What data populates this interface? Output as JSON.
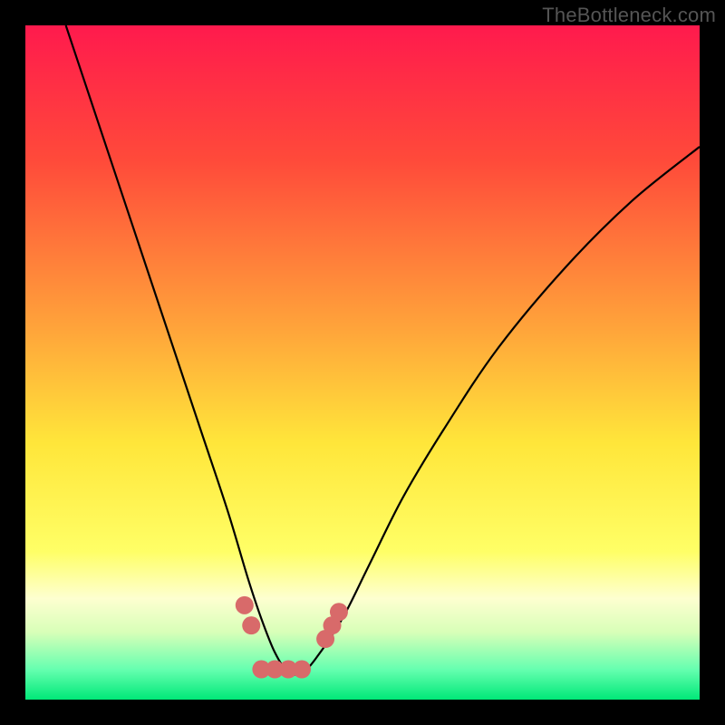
{
  "watermark": "TheBottleneck.com",
  "chart_data": {
    "type": "line",
    "title": "",
    "xlabel": "",
    "ylabel": "",
    "xlim": [
      0,
      100
    ],
    "ylim": [
      0,
      100
    ],
    "gradient_stops": [
      {
        "offset": 0,
        "color": "#ff1a4d"
      },
      {
        "offset": 0.2,
        "color": "#ff4a3a"
      },
      {
        "offset": 0.45,
        "color": "#ffa43a"
      },
      {
        "offset": 0.62,
        "color": "#ffe63a"
      },
      {
        "offset": 0.78,
        "color": "#ffff66"
      },
      {
        "offset": 0.85,
        "color": "#fdffd0"
      },
      {
        "offset": 0.9,
        "color": "#d8ffb8"
      },
      {
        "offset": 0.955,
        "color": "#66ffb0"
      },
      {
        "offset": 1.0,
        "color": "#00e878"
      }
    ],
    "series": [
      {
        "name": "bottleneck-curve",
        "x": [
          6,
          10,
          14,
          18,
          22,
          26,
          30,
          33,
          35,
          37,
          39,
          41,
          43,
          47,
          51,
          56,
          62,
          70,
          80,
          90,
          100
        ],
        "y": [
          100,
          88,
          76,
          64,
          52,
          40,
          28,
          18,
          12,
          7,
          4,
          4,
          6,
          12,
          20,
          30,
          40,
          52,
          64,
          74,
          82
        ]
      }
    ],
    "markers": {
      "name": "highlight-points",
      "color": "#d86a6a",
      "radius": 10,
      "points": [
        {
          "x": 32.5,
          "y": 14
        },
        {
          "x": 33.5,
          "y": 11
        },
        {
          "x": 35.0,
          "y": 4.5
        },
        {
          "x": 37.0,
          "y": 4.5
        },
        {
          "x": 39.0,
          "y": 4.5
        },
        {
          "x": 41.0,
          "y": 4.5
        },
        {
          "x": 44.5,
          "y": 9
        },
        {
          "x": 45.5,
          "y": 11
        },
        {
          "x": 46.5,
          "y": 13
        }
      ]
    }
  }
}
